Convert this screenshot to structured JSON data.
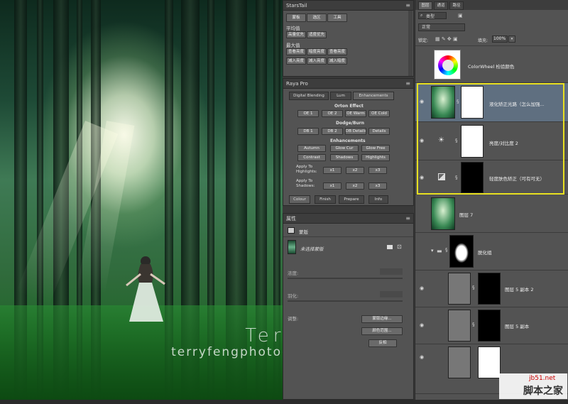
{
  "starstail": {
    "title": "StarsTail",
    "tab_buttons": [
      "蒙板",
      "选区",
      "工具"
    ],
    "section1": "平均值",
    "row1": [
      "高量优先",
      "适度优先"
    ],
    "section2": "最大值",
    "row2": [
      "查看亮度",
      "暗度亮度",
      "查看亮度"
    ],
    "row3": [
      "减入亮度",
      "减入亮度",
      "减入暗度"
    ]
  },
  "raya": {
    "title": "Raya Pro",
    "tabs": [
      "Digital Blending",
      "Lum",
      "Enhancements"
    ],
    "orton_title": "Orton Effect",
    "orton": [
      "OE 1",
      "OE 2",
      "OE Warm",
      "OE Cold"
    ],
    "dodge_title": "Dodge/Burn",
    "dodge": [
      "DB 1",
      "DB 2",
      "DB Details",
      "Details"
    ],
    "enh_title": "Enhancements",
    "enh1": [
      "Autumn",
      "Glow Cur",
      "Glow Free"
    ],
    "enh2": [
      "Contrast",
      "Shadows",
      "Highlights"
    ],
    "apply_high": "Apply To Highlights:",
    "apply_shadow": "Apply To Shadows:",
    "apply_btns": [
      "x1",
      "x2",
      "x3"
    ],
    "bottom": [
      "Colour",
      "Finish",
      "Prepare",
      "Info"
    ]
  },
  "props": {
    "title": "属性",
    "mask_label": "蒙版",
    "no_mask": "未选择蒙版",
    "density": "浓度:",
    "feather": "羽化:",
    "adjust": "调整:",
    "btn1": "蒙版边缘...",
    "btn2": "颜色范围...",
    "btn3": "反相"
  },
  "layers": {
    "tabs": [
      "图层",
      "通道",
      "路径"
    ],
    "filter_label": "类型",
    "blend_mode": "正常",
    "lock_label": "锁定:",
    "fill_label": "填充:",
    "fill_value": "100%",
    "items": [
      {
        "name": "ColorWheel 检验颜色",
        "type": "wheel"
      },
      {
        "name": "液化矫正光路（怎么加强...",
        "type": "photo",
        "selected": true
      },
      {
        "name": "亮度/对比度 2",
        "type": "adj"
      },
      {
        "name": "轻度肤色矫正（可有可无）",
        "type": "curve"
      },
      {
        "name": "图层 7",
        "type": "photo"
      },
      {
        "name": "脱化组",
        "type": "group"
      },
      {
        "name": "图层 5 副本 2",
        "type": "gray"
      },
      {
        "name": "图层 5 副本",
        "type": "gray"
      }
    ]
  },
  "photo": {
    "watermark_name": "Terry F",
    "watermark_url": "terryfengphotography.lofter.com"
  },
  "site": {
    "url": "jb51.net",
    "name": "脚本之家"
  },
  "colors": {
    "accent_yellow": "#e8e020",
    "selected_row": "#5f6f80"
  }
}
